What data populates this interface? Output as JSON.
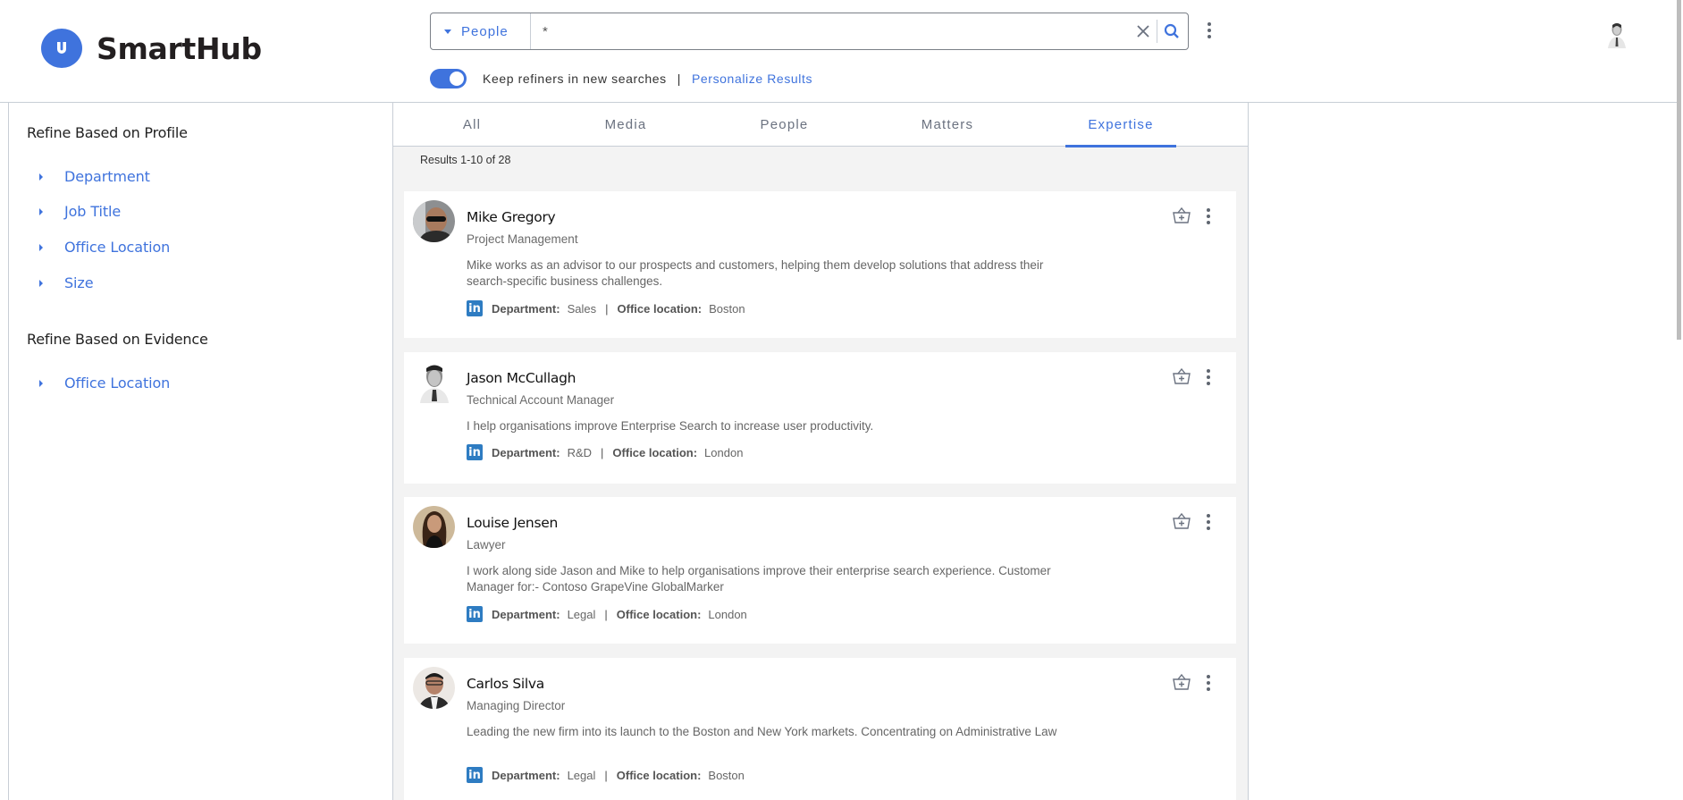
{
  "app": {
    "name": "SmartHub",
    "logo_letter": "U"
  },
  "search": {
    "scope": "People",
    "query": "*",
    "clear_icon": "close-icon",
    "search_icon": "search-icon"
  },
  "options": {
    "keep_refiners_label": "Keep refiners in new searches",
    "keep_refiners_on": true,
    "separator": "|",
    "personalize_label": "Personalize Results"
  },
  "refiners": {
    "profile_heading": "Refine Based on Profile",
    "profile_items": [
      {
        "label": "Department"
      },
      {
        "label": "Job Title"
      },
      {
        "label": "Office Location"
      },
      {
        "label": "Size"
      }
    ],
    "evidence_heading": "Refine Based on Evidence",
    "evidence_items": [
      {
        "label": "Office Location"
      }
    ]
  },
  "tabs": [
    {
      "label": "All",
      "active": false
    },
    {
      "label": "Media",
      "active": false
    },
    {
      "label": "People",
      "active": false
    },
    {
      "label": "Matters",
      "active": false
    },
    {
      "label": "Expertise",
      "active": true
    }
  ],
  "results_count": "Results 1-10 of 28",
  "meta_labels": {
    "department": "Department:",
    "office": "Office location:",
    "separator": "|",
    "linkedin": "in"
  },
  "results": [
    {
      "name": "Mike Gregory",
      "title": "Project Management",
      "description": "Mike works as an advisor to our prospects and customers, helping them develop solutions that address their search-specific business challenges.",
      "department": "Sales",
      "office": "Boston"
    },
    {
      "name": "Jason McCullagh",
      "title": "Technical Account Manager",
      "description": "I help organisations improve Enterprise Search to increase user productivity.",
      "department": "R&D",
      "office": "London"
    },
    {
      "name": "Louise Jensen",
      "title": "Lawyer",
      "description": "I work along side Jason and Mike to help organisations improve their enterprise search experience. Customer Manager for:- Contoso GrapeVine GlobalMarker",
      "department": "Legal",
      "office": "London"
    },
    {
      "name": "Carlos Silva",
      "title": "Managing Director",
      "description": "Leading the new firm into its launch to the Boston and New York markets. Concentrating on Administrative Law",
      "department": "Legal",
      "office": "Boston"
    }
  ],
  "colors": {
    "accent": "#3f73dd",
    "linkedin": "#2e7cc2",
    "results_bg": "#f3f3f3",
    "border": "#c8ced6"
  }
}
